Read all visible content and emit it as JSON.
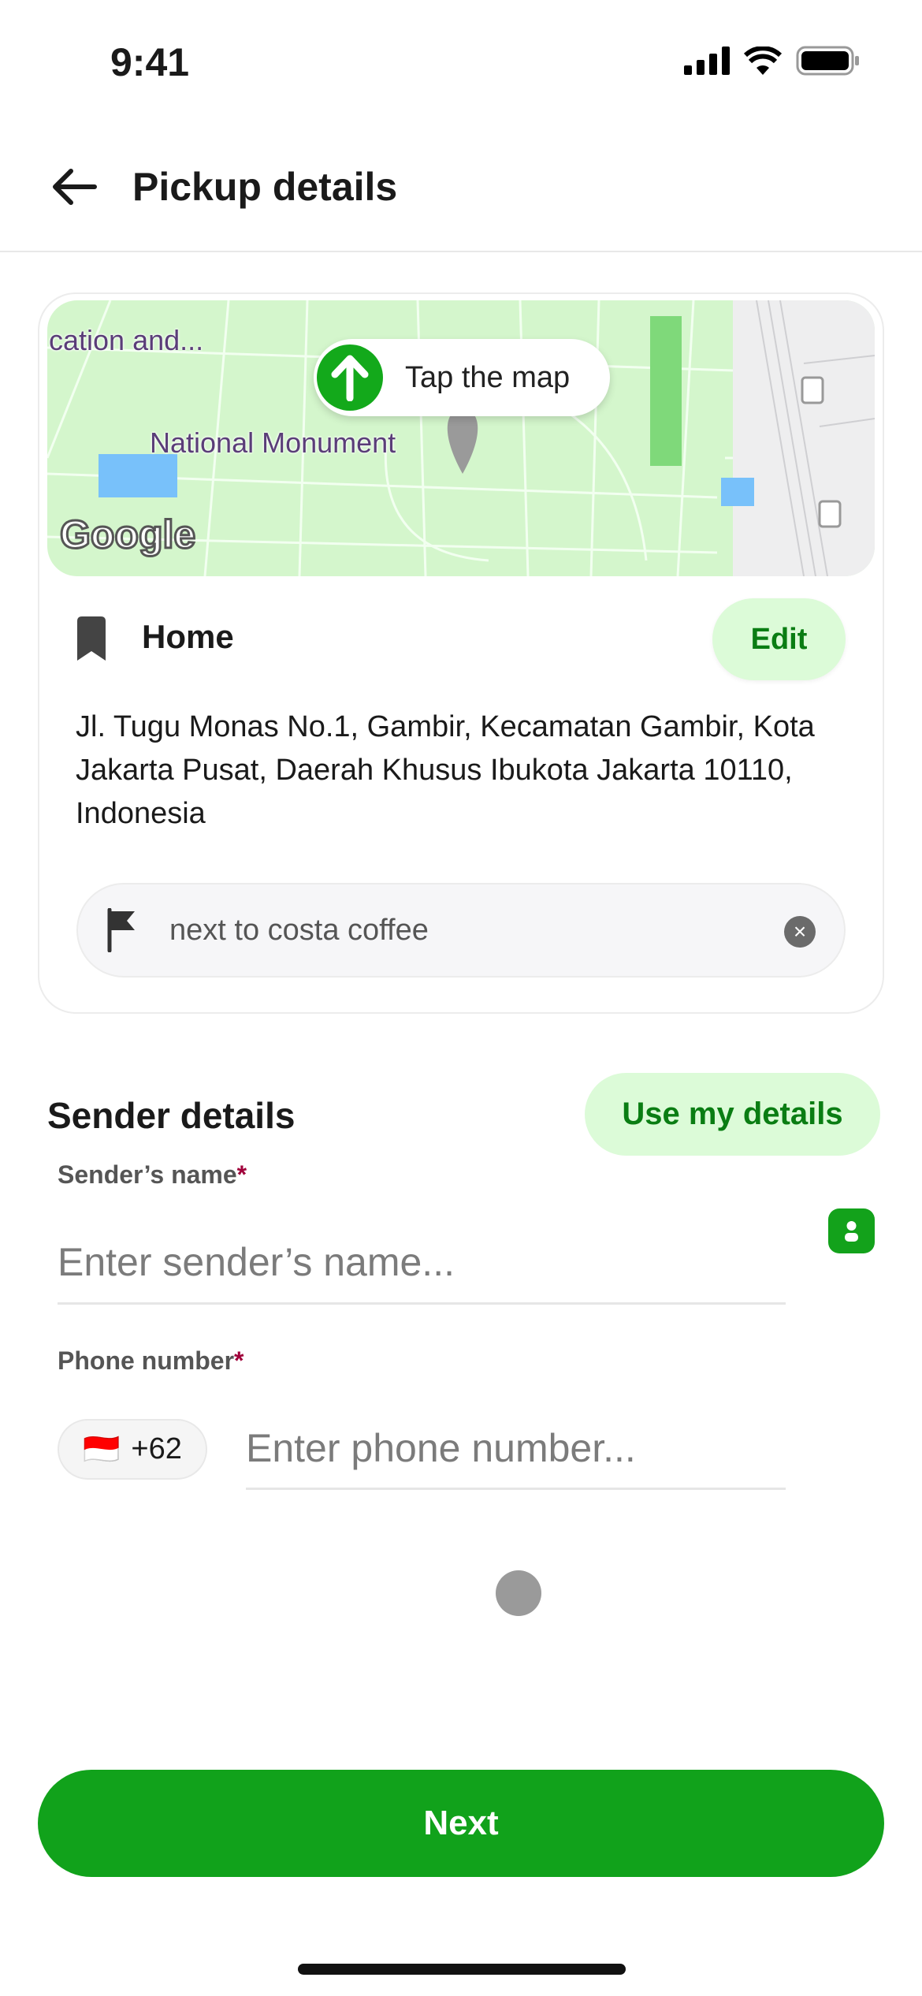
{
  "status_bar": {
    "time": "9:41"
  },
  "header": {
    "title": "Pickup details"
  },
  "map": {
    "tooltip": "Tap the map",
    "labels": [
      "cation and...",
      "National Monument"
    ],
    "logo": "Google"
  },
  "location": {
    "name": "Home",
    "edit_label": "Edit",
    "address": "Jl. Tugu Monas No.1, Gambir, Kecamatan Gambir, Kota Jakarta Pusat, Daerah Khusus Ibukota Jakarta 10110, Indonesia",
    "note_value": "next to costa coffee"
  },
  "sender": {
    "title": "Sender details",
    "use_my_details": "Use my details",
    "name_label": "Sender’s name",
    "name_placeholder": "Enter sender’s name...",
    "phone_label": "Phone number",
    "required_mark": "*",
    "country_code": "+62",
    "country_flag": "🇮🇩",
    "phone_placeholder": "Enter phone number..."
  },
  "footer": {
    "next_label": "Next"
  },
  "colors": {
    "accent": "#11a21b",
    "accent_light": "#dcfbd8",
    "required": "#a0003a"
  }
}
